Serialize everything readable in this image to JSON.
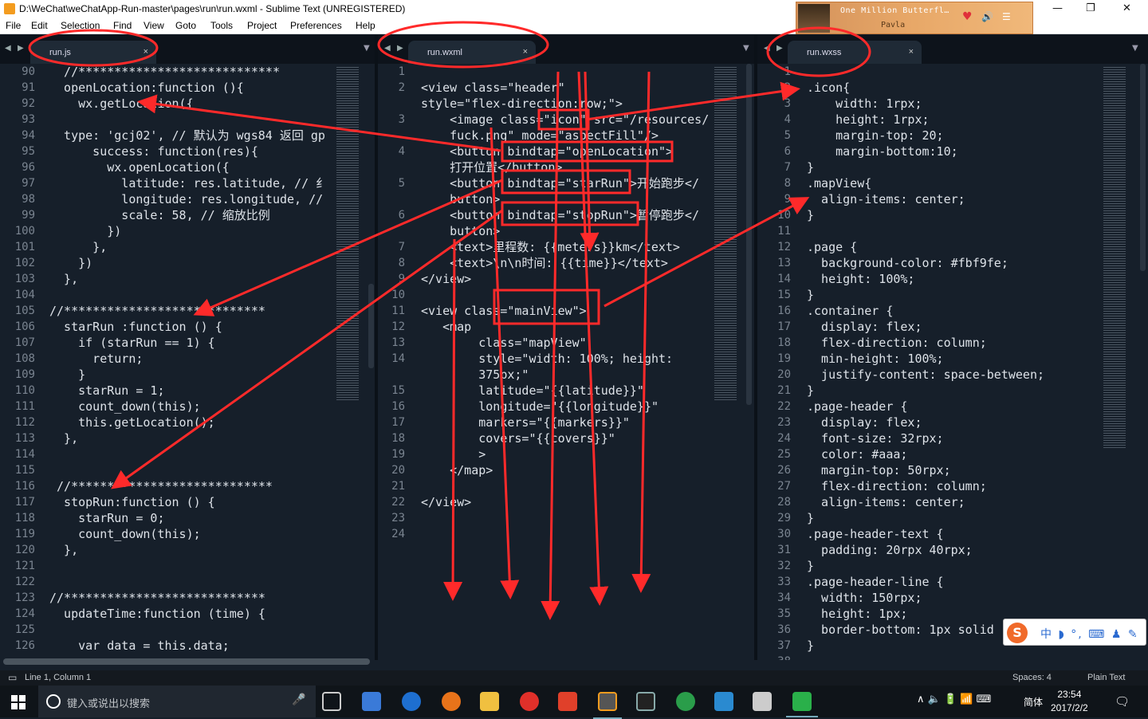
{
  "window": {
    "title": "D:\\WeChat\\weChatApp-Run-master\\pages\\run\\run.wxml - Sublime Text (UNREGISTERED)",
    "minimize": "—",
    "maximize": "❐",
    "close": "✕"
  },
  "menu": [
    "File",
    "Edit",
    "Selection",
    "Find",
    "View",
    "Goto",
    "Tools",
    "Project",
    "Preferences",
    "Help"
  ],
  "music": {
    "song": "One Million Butterfl…",
    "artist": "Pavla",
    "heart": "♥",
    "volume": "🔊",
    "list": "☰"
  },
  "tabs": {
    "left": "run.js",
    "middle": "run.wxml",
    "right": "run.wxss",
    "close": "×",
    "nav_prev": "◀",
    "nav_next": "▶",
    "dropdown": "▼"
  },
  "panes": {
    "js": {
      "numbers": [
        "90",
        "91",
        "92",
        "93",
        "94",
        "95",
        "96",
        "97",
        "98",
        "99",
        "100",
        "101",
        "102",
        "103",
        "104",
        "105",
        "106",
        "107",
        "108",
        "109",
        "110",
        "111",
        "112",
        "113",
        "114",
        "115",
        "116",
        "117",
        "118",
        "119",
        "120",
        "121",
        "122",
        "123",
        "124",
        "125",
        "126"
      ],
      "lines": [
        "  //****************************",
        "  openLocation:function (){",
        "    wx.getLocation({",
        "",
        "  type: 'gcj02', // 默认为 wgs84 返回 gp",
        "      success: function(res){",
        "        wx.openLocation({",
        "          latitude: res.latitude, // 纟",
        "          longitude: res.longitude, //",
        "          scale: 58, // 缩放比例",
        "        })",
        "      },",
        "    })",
        "  },",
        "",
        "//****************************",
        "  starRun :function () {",
        "    if (starRun == 1) {",
        "      return;",
        "    }",
        "    starRun = 1;",
        "    count_down(this);",
        "    this.getLocation();",
        "  },",
        "",
        "",
        " //****************************",
        "  stopRun:function () {",
        "    starRun = 0;",
        "    count_down(this);",
        "  },",
        "",
        "",
        "//****************************",
        "  updateTime:function (time) {",
        "",
        "    var data = this.data;"
      ]
    },
    "wxml": {
      "numbers": [
        "1",
        "2",
        "",
        "3",
        "",
        "4",
        "",
        "5",
        "",
        "6",
        "",
        "7",
        "8",
        "9",
        "10",
        "11",
        "12",
        "13",
        "14",
        "",
        "15",
        "16",
        "17",
        "18",
        "19",
        "20",
        "21",
        "22",
        "23",
        "24"
      ],
      "lines": [
        "",
        "<view class=\"header\"",
        "style=\"flex-direction:row;\">",
        "    <image class=\"icon\" src=\"/resources/",
        "    fuck.png\" mode=\"aspectFill\"/>",
        "    <button bindtap=\"openLocation\">",
        "    打开位置</button>",
        "    <button bindtap=\"starRun\">开始跑步</",
        "    button>",
        "    <button bindtap=\"stopRun\">暂停跑步</",
        "    button>",
        "    <text>里程数: {{meters}}km</text>",
        "    <text>\\n\\n时间: {{time}}</text>",
        "</view>",
        "",
        "<view class=\"mainView\">",
        "   <map",
        "        class=\"mapView\"",
        "        style=\"width: 100%; height:",
        "        375px;\"",
        "        latitude=\"{{latitude}}\"",
        "        longitude=\"{{longitude}}\"",
        "        markers=\"{{markers}}\"",
        "        covers=\"{{covers}}\"",
        "        >",
        "    </map>",
        "",
        "</view>",
        "",
        ""
      ]
    },
    "wxss": {
      "numbers": [
        "1",
        "2",
        "3",
        "4",
        "5",
        "6",
        "7",
        "8",
        "9",
        "10",
        "11",
        "12",
        "13",
        "14",
        "15",
        "16",
        "17",
        "18",
        "19",
        "20",
        "21",
        "22",
        "23",
        "24",
        "25",
        "26",
        "27",
        "28",
        "29",
        "30",
        "31",
        "32",
        "33",
        "34",
        "35",
        "36",
        "37",
        "38"
      ],
      "lines": [
        "",
        ".icon{",
        "    width: 1rpx;",
        "    height: 1rpx;",
        "    margin-top: 20;",
        "    margin-bottom:10;",
        "}",
        ".mapView{",
        "  align-items: center;",
        "}",
        "",
        ".page {",
        "  background-color: #fbf9fe;",
        "  height: 100%;",
        "}",
        ".container {",
        "  display: flex;",
        "  flex-direction: column;",
        "  min-height: 100%;",
        "  justify-content: space-between;",
        "}",
        ".page-header {",
        "  display: flex;",
        "  font-size: 32rpx;",
        "  color: #aaa;",
        "  margin-top: 50rpx;",
        "  flex-direction: column;",
        "  align-items: center;",
        "}",
        ".page-header-text {",
        "  padding: 20rpx 40rpx;",
        "}",
        ".page-header-line {",
        "  width: 150rpx;",
        "  height: 1px;",
        "  border-bottom: 1px solid",
        "}",
        ""
      ]
    }
  },
  "status": {
    "position": "Line 1, Column 1",
    "spaces": "Spaces: 4",
    "syntax": "Plain Text"
  },
  "taskbar": {
    "search_placeholder": "键入或说出以搜索",
    "time": "23:54",
    "date": "2017/2/2",
    "lang": "简体",
    "mic": "🎤",
    "notify": "🗨",
    "tray": "∧  🔈  🔋  📶  ⌨"
  },
  "ime": {
    "logo": "S",
    "options": "中 ◗ °, ⌨ ♟ ✎"
  },
  "colors": {
    "accent": "#f39c1f",
    "editor_bg": "#161f2a",
    "annotation": "#ff2a2a",
    "tab_bg": "#1f2a36"
  }
}
